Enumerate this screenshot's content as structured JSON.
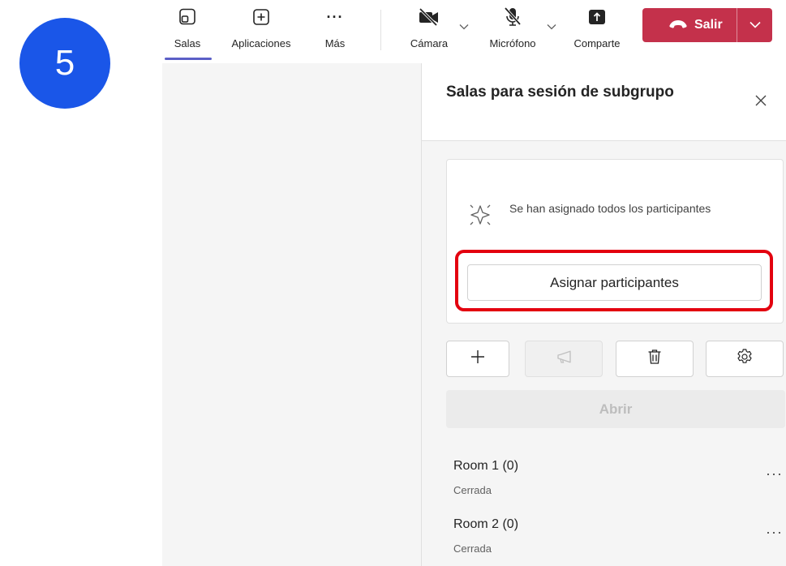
{
  "step_badge": "5",
  "toolbar": {
    "salas_label": "Salas",
    "apps_label": "Aplicaciones",
    "more_label": "Más",
    "more_glyph": "···",
    "camera_label": "Cámara",
    "mic_label": "Micrófono",
    "share_label": "Comparte",
    "leave_label": "Salir"
  },
  "panel": {
    "title": "Salas para sesión de subgrupo",
    "assign_message": "Se han asignado todos los participantes",
    "assign_button": "Asignar participantes",
    "open_button": "Abrir",
    "rooms": [
      {
        "name": "Room 1  (0)",
        "status": "Cerrada"
      },
      {
        "name": "Room 2  (0)",
        "status": "Cerrada"
      }
    ],
    "more_glyph": "···"
  },
  "colors": {
    "badge": "#1a56e8",
    "leave": "#c4314b",
    "highlight": "#e3000f",
    "active_tab": "#5b5fc7"
  },
  "icons": [
    "rooms-icon",
    "add-app-icon",
    "more-icon",
    "camera-off-icon",
    "mic-off-icon",
    "share-icon",
    "phone-hangup-icon",
    "chevron-down-icon",
    "close-icon",
    "sparkle-icon",
    "plus-icon",
    "megaphone-icon",
    "trash-icon",
    "gear-icon"
  ]
}
